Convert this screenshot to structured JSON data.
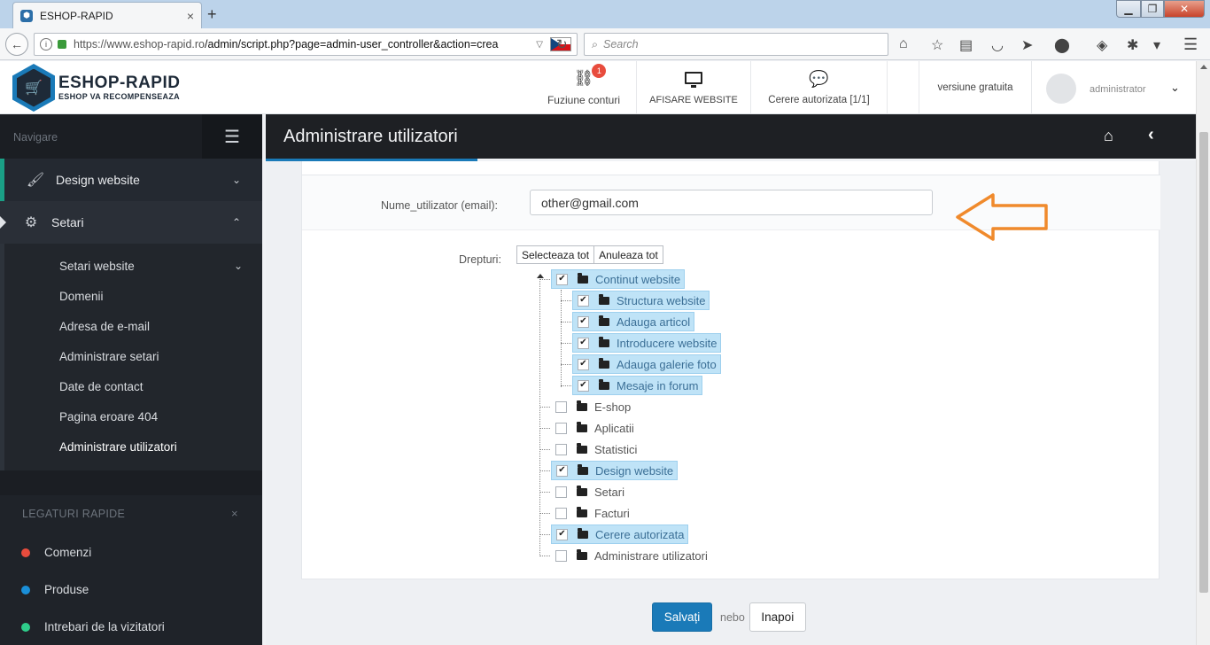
{
  "browser": {
    "tab_title": "ESHOP-RAPID",
    "url_host": "https://www.eshop-rapid.ro",
    "url_path": "/admin/script.php?page=admin-user_controller&action=crea",
    "search_placeholder": "Search"
  },
  "header": {
    "logo_title": "ESHOP-RAPID",
    "logo_subtitle": "ESHOP VA RECOMPENSEAZA",
    "merge_label": "Fuziune conturi",
    "merge_badge": "1",
    "website_label": "AFISARE WEBSITE",
    "requests_label": "Cerere autorizata [1/1]",
    "version_label": "versiune gratuita",
    "user_name": "administrator"
  },
  "sidebar": {
    "nav_label": "Navigare",
    "items": [
      {
        "label": "Design website"
      },
      {
        "label": "Setari"
      }
    ],
    "subitems": [
      {
        "label": "Setari website"
      },
      {
        "label": "Domenii"
      },
      {
        "label": "Adresa de e-mail"
      },
      {
        "label": "Administrare setari"
      },
      {
        "label": "Date de contact"
      },
      {
        "label": "Pagina eroare 404"
      },
      {
        "label": "Administrare utilizatori"
      }
    ],
    "quick_title": "LEGATURI RAPIDE",
    "quick_close": "×",
    "quick_links": [
      {
        "label": "Comenzi",
        "color": "#e84c3d"
      },
      {
        "label": "Produse",
        "color": "#1a8fd8"
      },
      {
        "label": "Intrebari de la vizitatori",
        "color": "#2ecc8a"
      }
    ]
  },
  "page": {
    "title": "Administrare utilizatori"
  },
  "form": {
    "username_label": "Nume_utilizator (email):",
    "username_value": "other@gmail.com",
    "rights_label": "Drepturi:",
    "select_all": "Selecteaza tot",
    "deselect_all": "Anuleaza tot",
    "tree": [
      {
        "label": "Continut website",
        "checked": true,
        "children": [
          {
            "label": "Structura website",
            "checked": true
          },
          {
            "label": "Adauga articol",
            "checked": true
          },
          {
            "label": "Introducere website",
            "checked": true
          },
          {
            "label": "Adauga galerie foto",
            "checked": true
          },
          {
            "label": "Mesaje in forum",
            "checked": true
          }
        ]
      },
      {
        "label": "E-shop",
        "checked": false
      },
      {
        "label": "Aplicatii",
        "checked": false
      },
      {
        "label": "Statistici",
        "checked": false
      },
      {
        "label": "Design website",
        "checked": true
      },
      {
        "label": "Setari",
        "checked": false
      },
      {
        "label": "Facturi",
        "checked": false
      },
      {
        "label": "Cerere autorizata",
        "checked": true
      },
      {
        "label": "Administrare utilizatori",
        "checked": false
      }
    ],
    "save_label": "Salvați",
    "or_label": "nebo",
    "back_label": "Inapoi"
  },
  "colors": {
    "accent": "#1a7ab8",
    "sidebar_bg": "#1f2329",
    "selected_node": "#bfe3f7",
    "arrow": "#f08a2c"
  }
}
